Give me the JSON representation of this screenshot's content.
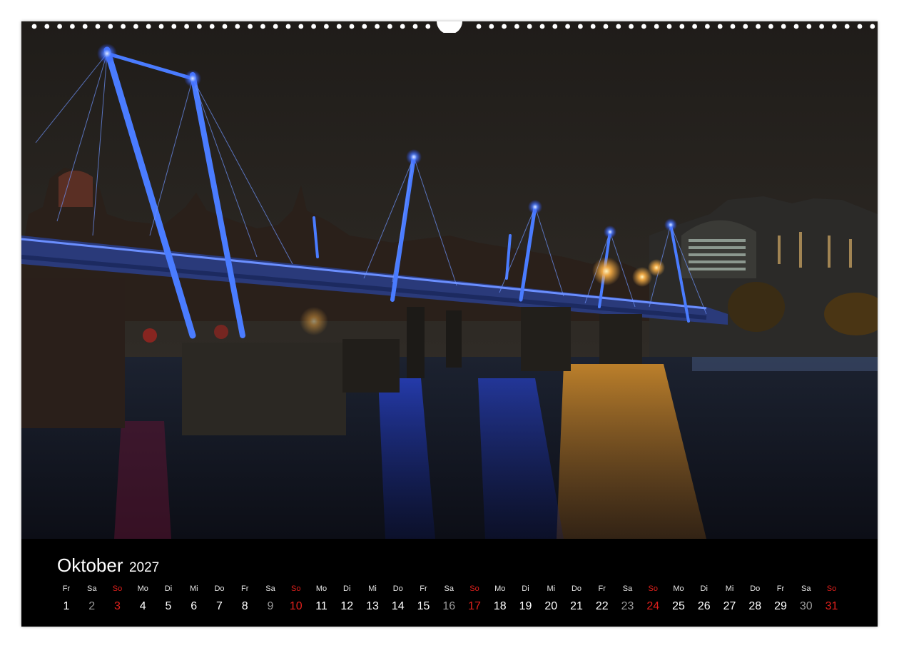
{
  "calendar": {
    "month": "Oktober",
    "year": "2027",
    "days": [
      {
        "wd": "Fr",
        "d": "1",
        "kind": "weekday"
      },
      {
        "wd": "Sa",
        "d": "2",
        "kind": "sat"
      },
      {
        "wd": "So",
        "d": "3",
        "kind": "sun"
      },
      {
        "wd": "Mo",
        "d": "4",
        "kind": "weekday"
      },
      {
        "wd": "Di",
        "d": "5",
        "kind": "weekday"
      },
      {
        "wd": "Mi",
        "d": "6",
        "kind": "weekday"
      },
      {
        "wd": "Do",
        "d": "7",
        "kind": "weekday"
      },
      {
        "wd": "Fr",
        "d": "8",
        "kind": "weekday"
      },
      {
        "wd": "Sa",
        "d": "9",
        "kind": "sat"
      },
      {
        "wd": "So",
        "d": "10",
        "kind": "sun"
      },
      {
        "wd": "Mo",
        "d": "11",
        "kind": "weekday"
      },
      {
        "wd": "Di",
        "d": "12",
        "kind": "weekday"
      },
      {
        "wd": "Mi",
        "d": "13",
        "kind": "weekday"
      },
      {
        "wd": "Do",
        "d": "14",
        "kind": "weekday"
      },
      {
        "wd": "Fr",
        "d": "15",
        "kind": "weekday"
      },
      {
        "wd": "Sa",
        "d": "16",
        "kind": "sat"
      },
      {
        "wd": "So",
        "d": "17",
        "kind": "sun"
      },
      {
        "wd": "Mo",
        "d": "18",
        "kind": "weekday"
      },
      {
        "wd": "Di",
        "d": "19",
        "kind": "weekday"
      },
      {
        "wd": "Mi",
        "d": "20",
        "kind": "weekday"
      },
      {
        "wd": "Do",
        "d": "21",
        "kind": "weekday"
      },
      {
        "wd": "Fr",
        "d": "22",
        "kind": "weekday"
      },
      {
        "wd": "Sa",
        "d": "23",
        "kind": "sat"
      },
      {
        "wd": "So",
        "d": "24",
        "kind": "sun"
      },
      {
        "wd": "Mo",
        "d": "25",
        "kind": "weekday"
      },
      {
        "wd": "Di",
        "d": "26",
        "kind": "weekday"
      },
      {
        "wd": "Mi",
        "d": "27",
        "kind": "weekday"
      },
      {
        "wd": "Do",
        "d": "28",
        "kind": "weekday"
      },
      {
        "wd": "Fr",
        "d": "29",
        "kind": "weekday"
      },
      {
        "wd": "Sa",
        "d": "30",
        "kind": "sat"
      },
      {
        "wd": "So",
        "d": "31",
        "kind": "sun"
      }
    ]
  },
  "colors": {
    "sunday": "#e0201c",
    "saturday": "#9a9a9a",
    "weekday": "#ffffff",
    "bridge_light": "#3a6bff",
    "lamp_glow": "#ffb347"
  }
}
